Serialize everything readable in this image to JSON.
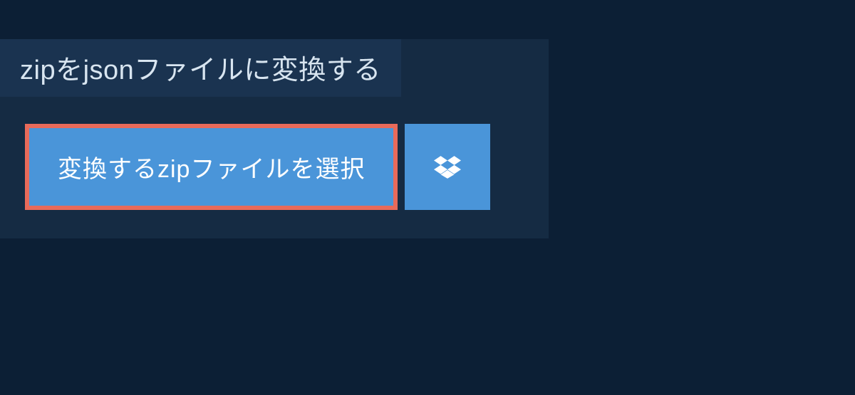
{
  "header": {
    "title": "zipをjsonファイルに変換する"
  },
  "actions": {
    "select_file_label": "変換するzipファイルを選択",
    "dropbox_label": "Dropbox"
  },
  "colors": {
    "background": "#0c1f35",
    "panel": "#152b43",
    "title_box": "#1a3350",
    "button": "#4a95d9",
    "highlight_border": "#e86a5a"
  }
}
